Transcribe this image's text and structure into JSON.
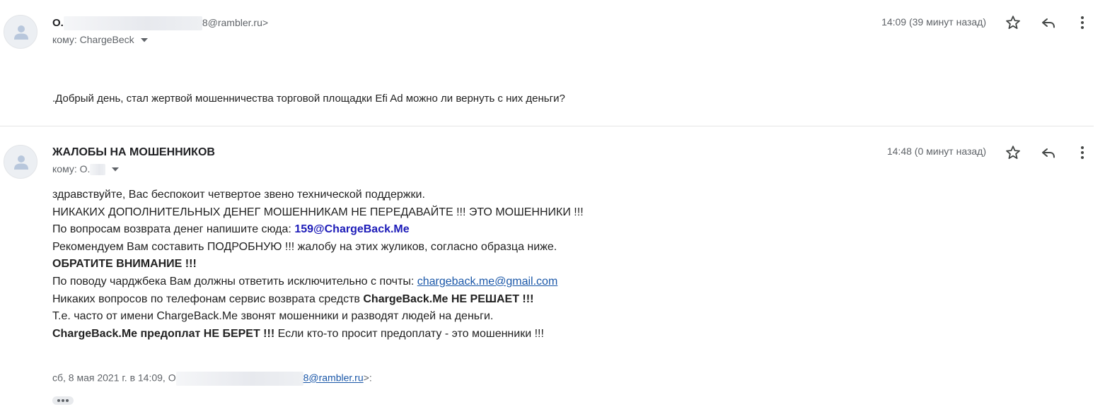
{
  "message1": {
    "sender_prefix": "О.",
    "sender_suffix": "8@rambler.ru>",
    "to_label": "кому: ChargeBeck",
    "time": "14:09 (39 минут назад)",
    "body": ".Добрый день, стал жертвой мошенничества торговой площадки Efi Ad можно ли вернуть с них деньги?"
  },
  "message2": {
    "sender": "ЖАЛОБЫ НА МОШЕННИКОВ",
    "to_label": "кому: О.",
    "time": "14:48 (0 минут назад)",
    "lines": {
      "l1": "здравствуйте, Вас беспокоит четвертое звено технической поддержки.",
      "l2": "НИКАКИХ ДОПОЛНИТЕЛЬНЫХ ДЕНЕГ МОШЕННИКАМ НЕ ПЕРЕДАВАЙТЕ !!! ЭТО МОШЕННИКИ !!!",
      "l3_text": "По вопросам возврата денег напишите сюда: ",
      "l3_email": "159@ChargeBack.Me",
      "l4": "Рекомендуем Вам составить ПОДРОБНУЮ !!! жалобу на этих жуликов, согласно образца ниже.",
      "l5": "ОБРАТИТЕ ВНИМАНИЕ !!!",
      "l6_text": "По поводу чарджбека Вам должны ответить исключительно с почты: ",
      "l6_email": "chargeback.me@gmail.com",
      "l7_text": "Никаких вопросов по телефонам сервис возврата средств ",
      "l7_bold": "ChargeBack.Me НЕ РЕШАЕТ !!!",
      "l8": "Т.е. часто от имени ChargeBack.Me звонят мошенники и разводят людей на деньги.",
      "l9_bold": "ChargeBack.Me предоплат НЕ БЕРЕТ !!!",
      "l9_text": " Если кто-то просит предоплату - это мошенники !!!"
    },
    "quote": {
      "prefix": "сб, 8 мая 2021 г. в 14:09, О",
      "email": "8@rambler.ru",
      "suffix": ">:"
    }
  },
  "icons": {
    "star": "star-icon",
    "reply": "reply-icon",
    "more": "more-vert-icon",
    "chevron": "chevron-down-icon",
    "avatar": "person-icon",
    "show_trimmed": "ellipsis-icon"
  }
}
